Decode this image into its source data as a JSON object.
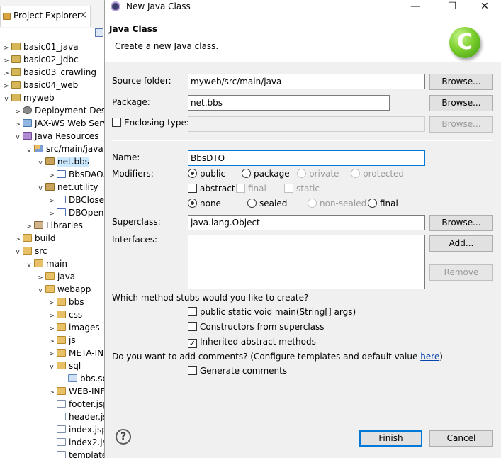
{
  "explorer": {
    "tab_label": "Project Explorer",
    "close_glyph": "×",
    "items": [
      {
        "label": "basic01_java",
        "icon": "project-icon"
      },
      {
        "label": "basic02_jdbc",
        "icon": "project-icon"
      },
      {
        "label": "basic03_crawling",
        "icon": "project-icon"
      },
      {
        "label": "basic04_web",
        "icon": "project-icon"
      },
      {
        "label": "myweb",
        "icon": "project-icon"
      },
      {
        "label": "Deployment Desc",
        "icon": "deployment-descriptor-icon"
      },
      {
        "label": "JAX-WS Web Serv",
        "icon": "web-service-icon"
      },
      {
        "label": "Java Resources",
        "icon": "java-resources-icon"
      },
      {
        "label": "src/main/java",
        "icon": "source-folder-icon"
      },
      {
        "label": "net.bbs",
        "icon": "package-icon"
      },
      {
        "label": "BbsDAO.",
        "icon": "java-file-icon"
      },
      {
        "label": "net.utility",
        "icon": "package-icon"
      },
      {
        "label": "DBClose.",
        "icon": "java-file-icon"
      },
      {
        "label": "DBOpen.",
        "icon": "java-file-icon"
      },
      {
        "label": "Libraries",
        "icon": "library-icon"
      },
      {
        "label": "build",
        "icon": "folder-icon"
      },
      {
        "label": "src",
        "icon": "folder-icon"
      },
      {
        "label": "main",
        "icon": "folder-icon"
      },
      {
        "label": "java",
        "icon": "folder-icon"
      },
      {
        "label": "webapp",
        "icon": "folder-icon"
      },
      {
        "label": "bbs",
        "icon": "folder-icon"
      },
      {
        "label": "css",
        "icon": "folder-icon"
      },
      {
        "label": "images",
        "icon": "folder-icon"
      },
      {
        "label": "js",
        "icon": "folder-icon"
      },
      {
        "label": "META-IN",
        "icon": "folder-icon"
      },
      {
        "label": "sql",
        "icon": "folder-icon"
      },
      {
        "label": "bbs.sc",
        "icon": "sql-file-icon"
      },
      {
        "label": "WEB-INF",
        "icon": "folder-icon"
      },
      {
        "label": "footer.jsp",
        "icon": "jsp-file-icon"
      },
      {
        "label": "header.js",
        "icon": "jsp-file-icon"
      },
      {
        "label": "index.jsp",
        "icon": "jsp-file-icon"
      },
      {
        "label": "index2.js",
        "icon": "jsp-file-icon"
      },
      {
        "label": "template",
        "icon": "jsp-file-icon"
      }
    ]
  },
  "dialog": {
    "window_title": "New Java Class",
    "heading": "Java Class",
    "description": "Create a new Java class.",
    "wizard_icon_letter": "C",
    "window_buttons": {
      "minimize": "—",
      "maximize": "☐",
      "close": "✕"
    },
    "source_folder": {
      "label": "Source folder:",
      "value": "myweb/src/main/java",
      "button": "Browse..."
    },
    "package": {
      "label": "Package:",
      "value": "net.bbs",
      "button": "Browse..."
    },
    "enclosing_type": {
      "label": "Enclosing type:",
      "value": "",
      "button": "Browse...",
      "checked": false
    },
    "name": {
      "label": "Name:",
      "value": "BbsDTO"
    },
    "modifiers": {
      "label": "Modifiers:",
      "access": [
        {
          "label": "public",
          "selected": true,
          "enabled": true
        },
        {
          "label": "package",
          "selected": false,
          "enabled": true
        },
        {
          "label": "private",
          "selected": false,
          "enabled": false
        },
        {
          "label": "protected",
          "selected": false,
          "enabled": false
        }
      ],
      "flags": [
        {
          "label": "abstract",
          "checked": false,
          "enabled": true
        },
        {
          "label": "final",
          "checked": false,
          "enabled": false
        },
        {
          "label": "static",
          "checked": false,
          "enabled": false
        }
      ],
      "sealing": [
        {
          "label": "none",
          "selected": true,
          "enabled": true
        },
        {
          "label": "sealed",
          "selected": false,
          "enabled": true
        },
        {
          "label": "non-sealed",
          "selected": false,
          "enabled": false
        },
        {
          "label": "final",
          "selected": false,
          "enabled": true
        }
      ]
    },
    "superclass": {
      "label": "Superclass:",
      "value": "java.lang.Object",
      "button": "Browse..."
    },
    "interfaces": {
      "label": "Interfaces:",
      "add_button": "Add...",
      "remove_button": "Remove"
    },
    "stubs": {
      "question": "Which method stubs would you like to create?",
      "options": [
        {
          "label": "public static void main(String[] args)",
          "checked": false
        },
        {
          "label": "Constructors from superclass",
          "checked": false
        },
        {
          "label": "Inherited abstract methods",
          "checked": true
        }
      ]
    },
    "comments": {
      "question": "Do you want to add comments? (Configure templates and default value ",
      "link": "here",
      "suffix": ")",
      "option": {
        "label": "Generate comments",
        "checked": false
      }
    },
    "help_glyph": "?",
    "finish_button": "Finish",
    "cancel_button": "Cancel",
    "check_glyph": "✓"
  }
}
